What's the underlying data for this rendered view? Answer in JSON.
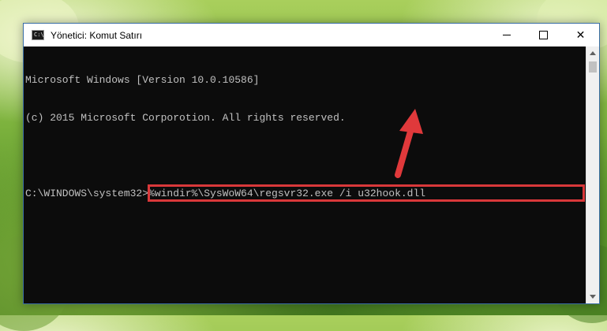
{
  "window": {
    "title": "Yönetici: Komut Satırı",
    "icon_label": "C:\\",
    "controls": {
      "minimize": "minimize-icon",
      "maximize": "maximize-icon",
      "close": "close-icon"
    }
  },
  "console": {
    "lines": [
      "Microsoft Windows [Version 10.0.10586]",
      "(c) 2015 Microsoft Corporotion. All rights reserved.",
      ""
    ],
    "prompt": "C:\\WINDOWS\\system32>",
    "command": "%windir%\\SysWoW64\\regsvr32.exe /i u32hook.dll"
  },
  "annotation": {
    "highlight_color": "#d9383a",
    "arrow_color": "#e0393b"
  },
  "close_glyph": "✕"
}
